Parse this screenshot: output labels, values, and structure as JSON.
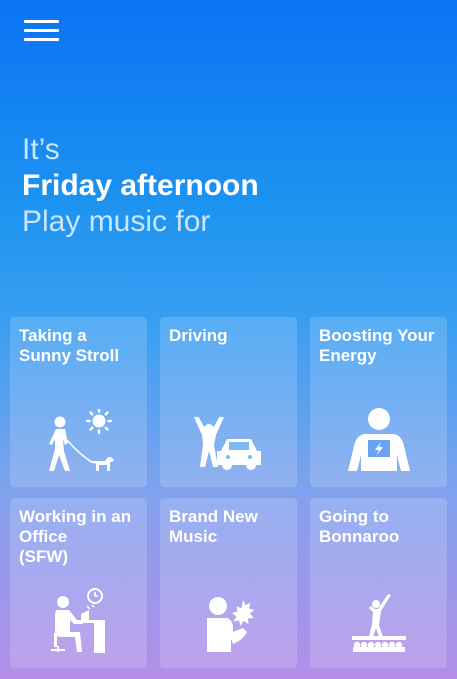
{
  "header": {
    "menu_icon": "hamburger-menu-icon"
  },
  "headline": {
    "line1": "It’s",
    "line2": "Friday afternoon",
    "line3": "Play music for"
  },
  "tiles": [
    {
      "label": "Taking a\nSunny Stroll",
      "icon": "walking-dog-sun-icon"
    },
    {
      "label": "Driving",
      "icon": "driving-car-icon"
    },
    {
      "label": "Boosting Your\nEnergy",
      "icon": "energy-person-icon"
    },
    {
      "label": "Working in an\nOffice\n (SFW)",
      "icon": "office-worker-icon"
    },
    {
      "label": "Brand New\nMusic",
      "icon": "new-music-icon"
    },
    {
      "label": "Going to\nBonnaroo",
      "icon": "concert-crowd-icon"
    }
  ]
}
